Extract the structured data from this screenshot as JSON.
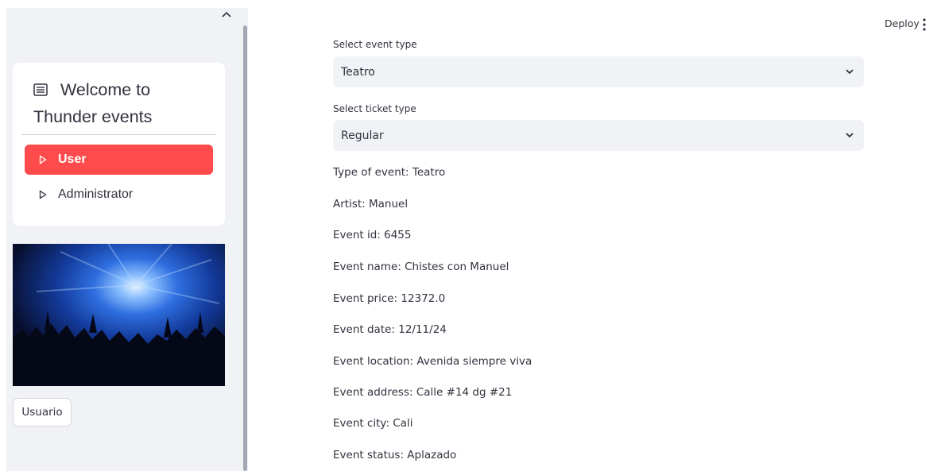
{
  "header": {
    "deploy_label": "Deploy"
  },
  "sidebar": {
    "title": "Welcome to Thunder events",
    "menu_items": [
      {
        "label": "User",
        "active": true
      },
      {
        "label": "Administrator",
        "active": false
      }
    ],
    "button_label": "Usuario",
    "accent_color": "#ff4b4b"
  },
  "main": {
    "event_type": {
      "label": "Select event type",
      "value": "Teatro"
    },
    "ticket_type": {
      "label": "Select ticket type",
      "value": "Regular"
    },
    "details": [
      "Type of event: Teatro",
      "Artist: Manuel",
      "Event id: 6455",
      "Event name: Chistes con Manuel",
      "Event price: 12372.0",
      "Event date: 12/11/24",
      "Event location: Avenida siempre viva",
      "Event address: Calle #14 dg #21",
      "Event city: Cali",
      "Event status: Aplazado"
    ]
  }
}
